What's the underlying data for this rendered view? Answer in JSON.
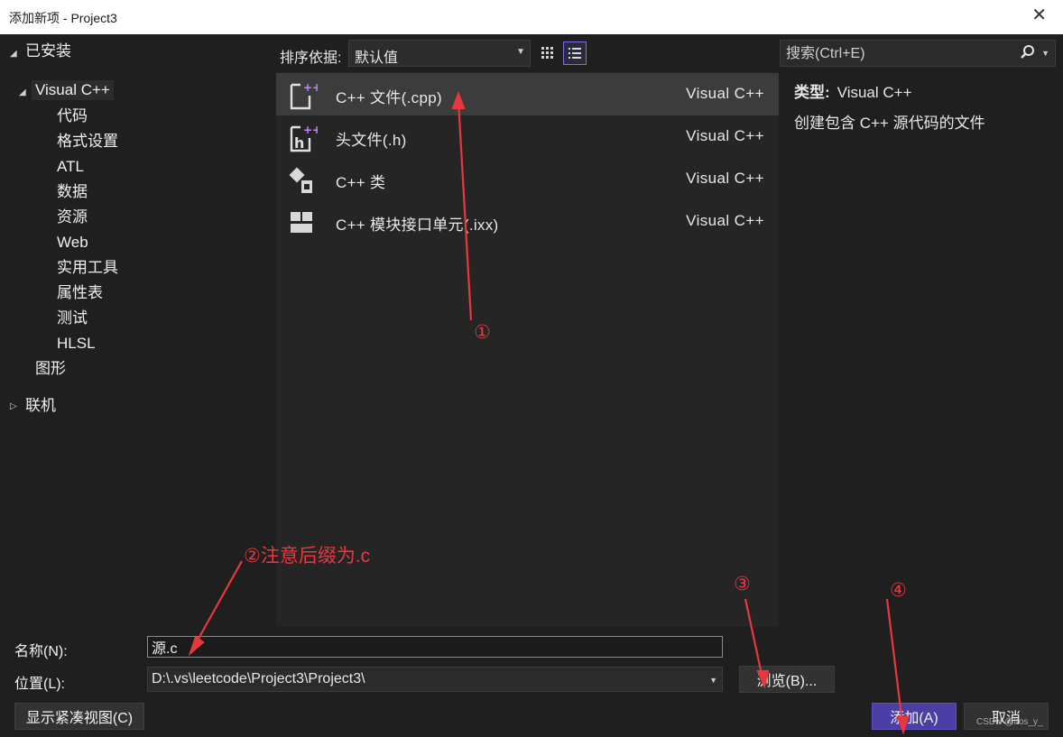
{
  "window": {
    "title": "添加新项 - Project3",
    "close_glyph": "✕"
  },
  "sidebar": {
    "installed": "已安装",
    "visual_cpp": "Visual C++",
    "children": [
      "代码",
      "格式设置",
      "ATL",
      "数据",
      "资源",
      "Web",
      "实用工具",
      "属性表",
      "测试",
      "HLSL"
    ],
    "graphics": "图形",
    "online": "联机"
  },
  "toolbar": {
    "sort_label": "排序依据:",
    "sort_value": "默认值"
  },
  "templates": [
    {
      "name": "C++ 文件(.cpp)",
      "lang": "Visual C++",
      "icon": "cpp-file-icon"
    },
    {
      "name": "头文件(.h)",
      "lang": "Visual C++",
      "icon": "header-file-icon"
    },
    {
      "name": "C++ 类",
      "lang": "Visual C++",
      "icon": "cpp-class-icon"
    },
    {
      "name": "C++ 模块接口单元(.ixx)",
      "lang": "Visual C++",
      "icon": "module-interface-icon"
    }
  ],
  "search": {
    "placeholder": "搜索(Ctrl+E)"
  },
  "details": {
    "type_label": "类型:",
    "type_value": "Visual C++",
    "description": "创建包含 C++ 源代码的文件"
  },
  "form": {
    "name_label": "名称(N):",
    "name_value": "源.c",
    "location_label": "位置(L):",
    "location_value": "D:\\.vs\\leetcode\\Project3\\Project3\\",
    "browse_label": "浏览(B)...",
    "compact_label": "显示紧凑视图(C)",
    "add_label": "添加(A)",
    "cancel_label": "取消"
  },
  "watermark": "CSDN @Itos_y_",
  "annotations": {
    "a1": "①",
    "a2": "②注意后缀为.c",
    "a3": "③",
    "a4": "④",
    "color": "#e8383d"
  },
  "colors": {
    "accent": "#4b3fa6",
    "selection": "#3c3c3c",
    "background": "#1f1f1f"
  }
}
